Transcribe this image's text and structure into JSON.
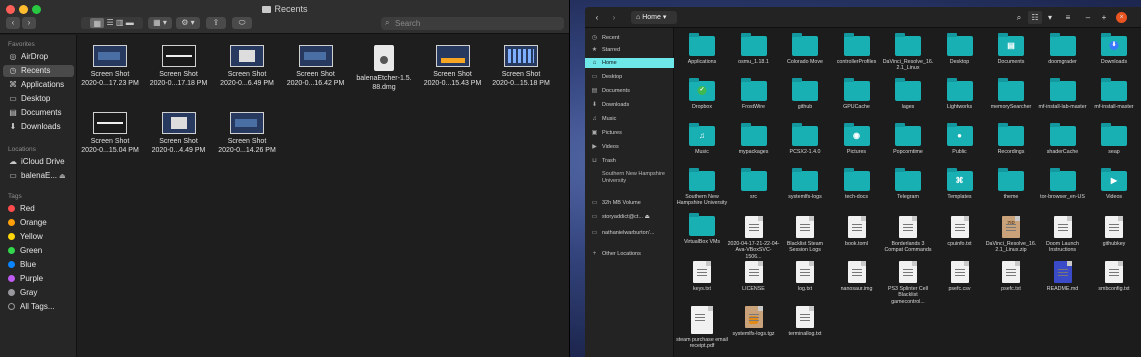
{
  "finder": {
    "title": "Recents",
    "search_placeholder": "Search",
    "sidebar": {
      "favorites_header": "Favorites",
      "favorites": [
        {
          "label": "AirDrop",
          "icon": "airdrop-icon"
        },
        {
          "label": "Recents",
          "icon": "clock-icon",
          "selected": true
        },
        {
          "label": "Applications",
          "icon": "applications-icon"
        },
        {
          "label": "Desktop",
          "icon": "desktop-icon"
        },
        {
          "label": "Documents",
          "icon": "documents-icon"
        },
        {
          "label": "Downloads",
          "icon": "downloads-icon"
        }
      ],
      "locations_header": "Locations",
      "locations": [
        {
          "label": "iCloud Drive",
          "icon": "cloud-icon"
        },
        {
          "label": "balenaE...",
          "icon": "disk-icon"
        }
      ],
      "tags_header": "Tags",
      "tags": [
        {
          "label": "Red",
          "color": "#ff4b4b"
        },
        {
          "label": "Orange",
          "color": "#ff9f0a"
        },
        {
          "label": "Yellow",
          "color": "#ffd60a"
        },
        {
          "label": "Green",
          "color": "#32d74b"
        },
        {
          "label": "Blue",
          "color": "#0a84ff"
        },
        {
          "label": "Purple",
          "color": "#bf5af2"
        },
        {
          "label": "Gray",
          "color": "#98989d"
        },
        {
          "label": "All Tags...",
          "color": ""
        }
      ]
    },
    "files": [
      {
        "line1": "Screen Shot",
        "line2": "2020-0...17.23 PM",
        "kind": "screenshot-dark"
      },
      {
        "line1": "Screen Shot",
        "line2": "2020-0...17.18 PM",
        "kind": "screenshot-bar"
      },
      {
        "line1": "Screen Shot",
        "line2": "2020-0...6.49 PM",
        "kind": "screenshot-window"
      },
      {
        "line1": "Screen Shot",
        "line2": "2020-0...16.42 PM",
        "kind": "screenshot-dark"
      },
      {
        "line1": "balenaEtcher-1.5.",
        "line2": "88.dmg",
        "kind": "dmg"
      },
      {
        "line1": "Screen Shot",
        "line2": "2020-0...15.43 PM",
        "kind": "screenshot-dock"
      },
      {
        "line1": "Screen Shot",
        "line2": "2020-0...15.18 PM",
        "kind": "screenshot-apps"
      },
      {
        "line1": "Screen Shot",
        "line2": "2020-0...15.04 PM",
        "kind": "screenshot-bar"
      },
      {
        "line1": "Screen Shot",
        "line2": "2020-0...4.49 PM",
        "kind": "screenshot-window"
      },
      {
        "line1": "Screen Shot",
        "line2": "2020-0...14.26 PM",
        "kind": "screenshot-dark"
      }
    ]
  },
  "nautilus": {
    "path_label": "Home",
    "sidebar": [
      {
        "label": "Recent",
        "icon": "clock-icon"
      },
      {
        "label": "Starred",
        "icon": "star-icon"
      },
      {
        "label": "Home",
        "icon": "home-icon",
        "selected": true
      },
      {
        "label": "Desktop",
        "icon": "desktop-icon"
      },
      {
        "label": "Documents",
        "icon": "documents-icon"
      },
      {
        "label": "Downloads",
        "icon": "downloads-icon"
      },
      {
        "label": "Music",
        "icon": "music-icon"
      },
      {
        "label": "Pictures",
        "icon": "pictures-icon"
      },
      {
        "label": "Videos",
        "icon": "videos-icon"
      },
      {
        "label": "Trash",
        "icon": "trash-icon"
      },
      {
        "label": "Southern New Hampshire University",
        "icon": "folder-icon"
      },
      {
        "label": "32h MB Volume",
        "icon": "drive-icon"
      },
      {
        "label": "storyaddict@ct...",
        "icon": "network-icon"
      },
      {
        "label": "nathanielwarburton'...",
        "icon": "network-icon"
      },
      {
        "label": "Other Locations",
        "icon": "plus-icon"
      }
    ],
    "items": [
      {
        "name": "Applications",
        "type": "folder"
      },
      {
        "name": "osmu_1.18.1",
        "type": "folder"
      },
      {
        "name": "Colorado Move",
        "type": "folder"
      },
      {
        "name": "controllerProfiles",
        "type": "folder"
      },
      {
        "name": "DaVinci_Resolve_16.2.1_Linux",
        "type": "folder"
      },
      {
        "name": "Desktop",
        "type": "folder"
      },
      {
        "name": "Documents",
        "type": "folder",
        "emblem": "document"
      },
      {
        "name": "doomgrader",
        "type": "folder"
      },
      {
        "name": "Downloads",
        "type": "folder",
        "emblem": "download"
      },
      {
        "name": "Dropbox",
        "type": "folder",
        "emblem": "check"
      },
      {
        "name": "FrostWire",
        "type": "folder"
      },
      {
        "name": "github",
        "type": "folder"
      },
      {
        "name": "GPUCache",
        "type": "folder"
      },
      {
        "name": "lages",
        "type": "folder"
      },
      {
        "name": "Lightworks",
        "type": "folder"
      },
      {
        "name": "memorySearcher",
        "type": "folder"
      },
      {
        "name": "mf-install-lab-master",
        "type": "folder"
      },
      {
        "name": "mf-install-master",
        "type": "folder"
      },
      {
        "name": "Music",
        "type": "folder",
        "emblem": "music"
      },
      {
        "name": "mypackages",
        "type": "folder"
      },
      {
        "name": "PCSX2-1.4.0",
        "type": "folder"
      },
      {
        "name": "Pictures",
        "type": "folder",
        "emblem": "camera"
      },
      {
        "name": "Popcorntime",
        "type": "folder"
      },
      {
        "name": "Public",
        "type": "folder",
        "emblem": "person"
      },
      {
        "name": "Recordings",
        "type": "folder"
      },
      {
        "name": "shaderCache",
        "type": "folder"
      },
      {
        "name": "seap",
        "type": "folder"
      },
      {
        "name": "Southern New Hampshire University",
        "type": "folder"
      },
      {
        "name": "src",
        "type": "folder"
      },
      {
        "name": "systemlfs-logs",
        "type": "folder"
      },
      {
        "name": "tech-docs",
        "type": "folder"
      },
      {
        "name": "Telegram",
        "type": "folder"
      },
      {
        "name": "Templates",
        "type": "folder",
        "emblem": "template"
      },
      {
        "name": "theme",
        "type": "folder"
      },
      {
        "name": "tor-browser_en-US",
        "type": "folder"
      },
      {
        "name": "Videos",
        "type": "folder",
        "emblem": "video"
      },
      {
        "name": "VirtualBox VMs",
        "type": "folder"
      },
      {
        "name": "2020-04-17-21-22-04-Ava-VBoxSVC-1506...",
        "type": "doc"
      },
      {
        "name": "Blacklist Steam Session Logs",
        "type": "doc"
      },
      {
        "name": "book.toml",
        "type": "doc"
      },
      {
        "name": "Borderlands 3 Compat Commands",
        "type": "doc"
      },
      {
        "name": "cpuinfo.txt",
        "type": "doc"
      },
      {
        "name": "DaVinci_Resolve_16.2.1_Linux.zip",
        "type": "zip"
      },
      {
        "name": "Doom Launch Instructions",
        "type": "doc"
      },
      {
        "name": "githubkey",
        "type": "doc"
      },
      {
        "name": "keys.txt",
        "type": "doc"
      },
      {
        "name": "LICENSE",
        "type": "doc"
      },
      {
        "name": "log.txt",
        "type": "doc"
      },
      {
        "name": "nanosaur.img",
        "type": "doc"
      },
      {
        "name": "PS3 Splinter Cell Blacklist gamecontrol...",
        "type": "doc"
      },
      {
        "name": "psefc.csv",
        "type": "doc"
      },
      {
        "name": "psefc.txt",
        "type": "doc"
      },
      {
        "name": "README.md",
        "type": "readme"
      },
      {
        "name": "smbconfig.txt",
        "type": "doc"
      },
      {
        "name": "steam purchase email receipt.pdf",
        "type": "pdf"
      },
      {
        "name": "systemlfs-logs.tgz",
        "type": "tgz"
      },
      {
        "name": "terminallog.txt",
        "type": "doc"
      }
    ]
  }
}
